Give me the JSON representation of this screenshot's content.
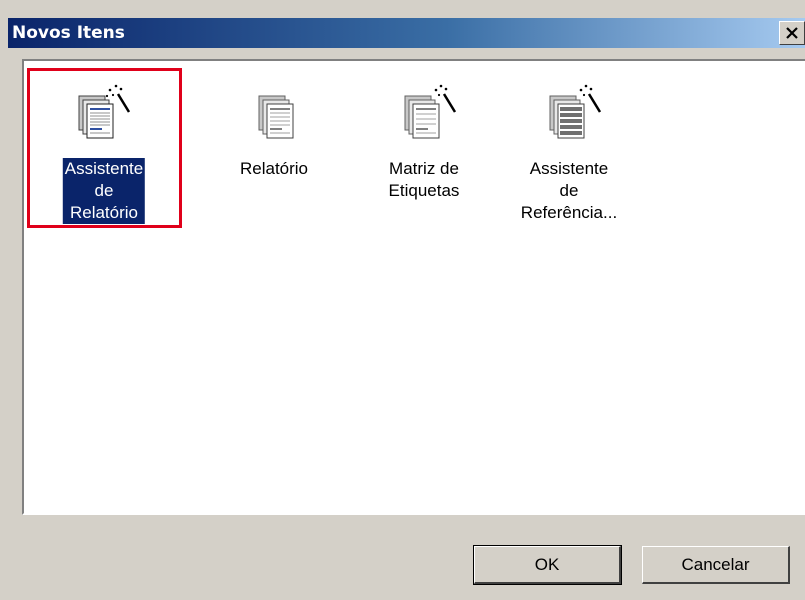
{
  "window": {
    "title": "Novos Itens",
    "close_glyph": "✕"
  },
  "items": [
    {
      "label": "Assistente de\nRelatório",
      "icon": "report-wizard-icon",
      "selected": true
    },
    {
      "label": "Relatório",
      "icon": "report-icon",
      "selected": false
    },
    {
      "label": "Matriz de\nEtiquetas",
      "icon": "label-matrix-icon",
      "selected": false
    },
    {
      "label": "Assistente de\nReferência...",
      "icon": "cross-reference-wizard-icon",
      "selected": false
    }
  ],
  "buttons": {
    "ok": "OK",
    "cancel": "Cancelar"
  },
  "colors": {
    "title_bar_start": "#0a246a",
    "title_bar_end": "#a6caf0",
    "selection_highlight": "#0a246a",
    "annotation_box": "#e0001a"
  }
}
